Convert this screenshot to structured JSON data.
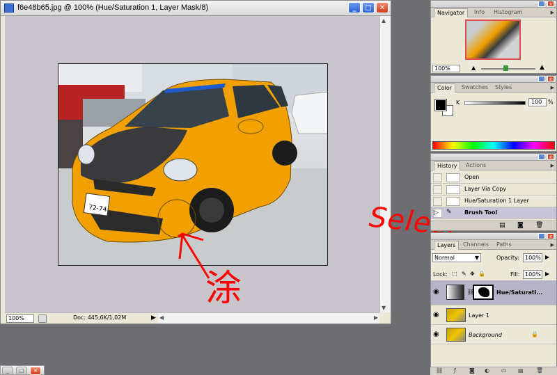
{
  "document": {
    "title": "f6e48b65.jpg @ 100% (Hue/Saturation 1, Layer Mask/8)",
    "zoom": "100%",
    "doc_info": "Doc: 445,6K/1,02M",
    "photo": {
      "plate_top": "",
      "plate_bottom": "72-74"
    }
  },
  "navigator": {
    "tabs": [
      "Navigator",
      "Info",
      "Histogram"
    ],
    "zoom": "100%"
  },
  "color": {
    "tabs": [
      "Color",
      "Swatches",
      "Styles"
    ],
    "channel_label": "K",
    "channel_value": "100",
    "unit": "%"
  },
  "history": {
    "tabs": [
      "History",
      "Actions"
    ],
    "items": [
      "Open",
      "Layer Via Copy",
      "Hue/Saturation 1 Layer",
      "Brush Tool"
    ]
  },
  "layers": {
    "tabs": [
      "Layers",
      "Channels",
      "Paths"
    ],
    "blend_mode": "Normal",
    "opacity_label": "Opacity:",
    "opacity": "100%",
    "lock_label": "Lock:",
    "fill_label": "Fill:",
    "fill": "100%",
    "items": [
      {
        "name": "Hue/Saturati..."
      },
      {
        "name": "Layer 1"
      },
      {
        "name": "Background"
      }
    ]
  },
  "annotations": {
    "select": "Select",
    "tu": "涂"
  },
  "colors": {
    "annotation": "#ff0000",
    "car_orange": "#f2a000"
  }
}
